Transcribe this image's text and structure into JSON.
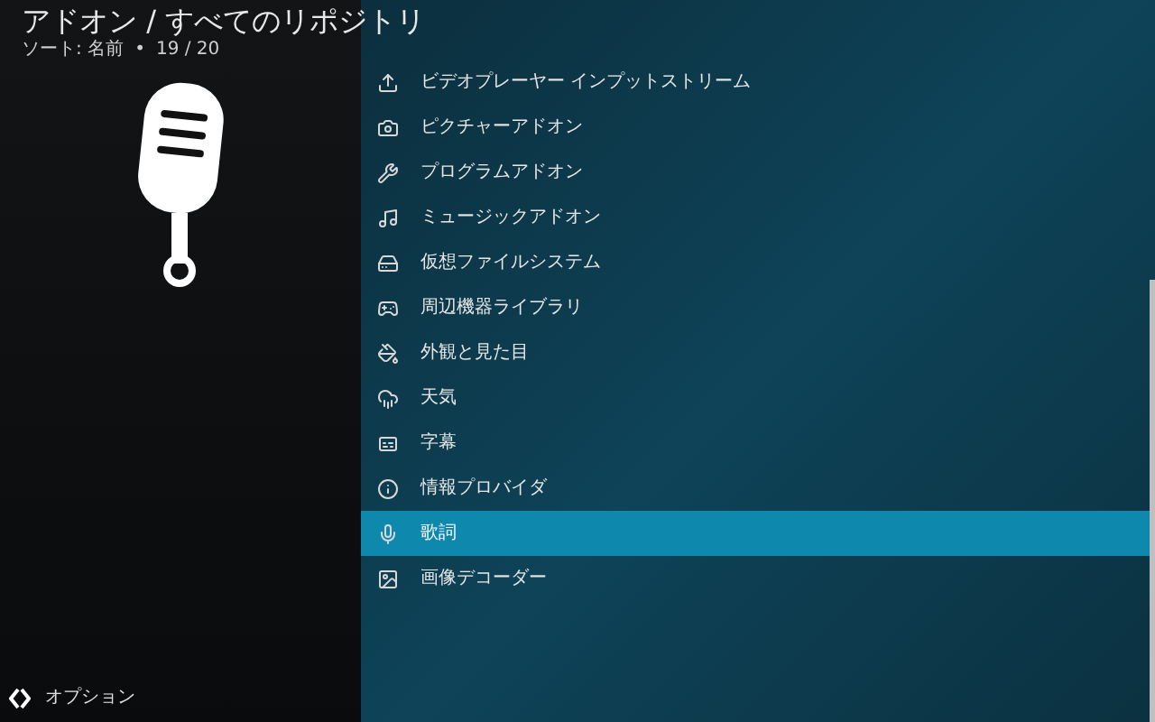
{
  "header": {
    "title": "アドオン / すべてのリポジトリ",
    "sort": "ソート: 名前",
    "bullet": "•",
    "count": "19 / 20"
  },
  "items": [
    {
      "kind": "inputstream",
      "label": "ビデオプレーヤー インプットストリーム",
      "selected": false
    },
    {
      "kind": "picture",
      "label": "ピクチャーアドオン",
      "selected": false
    },
    {
      "kind": "program",
      "label": "プログラムアドオン",
      "selected": false
    },
    {
      "kind": "music",
      "label": "ミュージックアドオン",
      "selected": false
    },
    {
      "kind": "vfs",
      "label": "仮想ファイルシステム",
      "selected": false
    },
    {
      "kind": "peripheral",
      "label": "周辺機器ライブラリ",
      "selected": false
    },
    {
      "kind": "skin",
      "label": "外観と見た目",
      "selected": false
    },
    {
      "kind": "weather",
      "label": "天気",
      "selected": false
    },
    {
      "kind": "subtitles",
      "label": "字幕",
      "selected": false
    },
    {
      "kind": "info",
      "label": "情報プロバイダ",
      "selected": false
    },
    {
      "kind": "lyrics",
      "label": "歌詞",
      "selected": true
    },
    {
      "kind": "image",
      "label": "画像デコーダー",
      "selected": false
    }
  ],
  "footer": {
    "options": "オプション"
  }
}
